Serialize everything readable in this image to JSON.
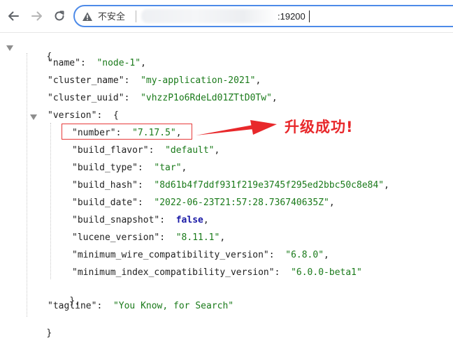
{
  "toolbar": {
    "back_icon": "arrow-left-icon",
    "forward_icon": "arrow-right-icon",
    "reload_icon": "reload-icon",
    "security_icon": "warning-triangle-icon",
    "security_label": "不安全",
    "url_port": ":19200"
  },
  "json": {
    "open_brace": "{",
    "name_key": "\"name\"",
    "name_value": "\"node-1\"",
    "cluster_name_key": "\"cluster_name\"",
    "cluster_name_value": "\"my-application-2021\"",
    "cluster_uuid_key": "\"cluster_uuid\"",
    "cluster_uuid_value": "\"vhzzP1o6RdeLd01ZTtD0Tw\"",
    "version_key": "\"version\"",
    "version_open": "{",
    "number_key": "\"number\"",
    "number_value": "\"7.17.5\"",
    "build_flavor_key": "\"build_flavor\"",
    "build_flavor_value": "\"default\"",
    "build_type_key": "\"build_type\"",
    "build_type_value": "\"tar\"",
    "build_hash_key": "\"build_hash\"",
    "build_hash_value": "\"8d61b4f7ddf931f219e3745f295ed2bbc50c8e84\"",
    "build_date_key": "\"build_date\"",
    "build_date_value": "\"2022-06-23T21:57:28.736740635Z\"",
    "build_snapshot_key": "\"build_snapshot\"",
    "build_snapshot_value": "false",
    "lucene_version_key": "\"lucene_version\"",
    "lucene_version_value": "\"8.11.1\"",
    "min_wire_key": "\"minimum_wire_compatibility_version\"",
    "min_wire_value": "\"6.8.0\"",
    "min_index_key": "\"minimum_index_compatibility_version\"",
    "min_index_value": "\"6.0.0-beta1\"",
    "version_close": "},",
    "tagline_key": "\"tagline\"",
    "tagline_value": "\"You Know, for Search\"",
    "close_brace": "}"
  },
  "annotation": {
    "text": "升级成功!",
    "color": "#e8282b"
  }
}
